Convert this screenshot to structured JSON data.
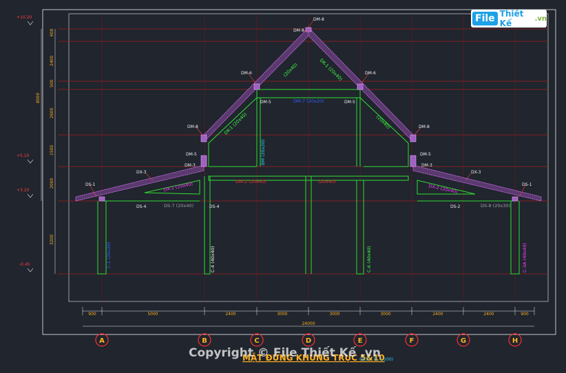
{
  "title": "MẶT ĐỨNG KHUNG TRỤC 5&10",
  "title_scale": "(SCX - TL 1:100)",
  "watermark": "Copyright © File Thiết Kế .vn",
  "logo": {
    "file": "File",
    "thiet_ke": "Thiết Kế",
    "domain": ".vn"
  },
  "levels": [
    "+10.20",
    "+5.10",
    "+3.20",
    "-0.45"
  ],
  "vertical_dims": [
    "600",
    "2400",
    "500",
    "2600",
    "1500",
    "2000",
    "3200",
    "8000"
  ],
  "axis_labels": [
    "A",
    "B",
    "C",
    "D",
    "E",
    "F",
    "G",
    "H"
  ],
  "bottom_dims": [
    "900",
    "5000",
    "2400",
    "3000",
    "3000",
    "3000",
    "2400",
    "2400",
    "900"
  ],
  "total_dim": "24000",
  "node_labels": {
    "dm_top": "DM-8",
    "dm_left_top": "DM-8",
    "dm_right_top": "DM-8",
    "dm_left_mid": "DM-6",
    "dm_right_mid": "DM-6",
    "dm_left_5": "DM-5",
    "dm_right_5": "DM-5",
    "dm_left_low": "DM-5",
    "dm_right_low": "DM-5",
    "dm_left_3": "DM-3",
    "dm_right_3": "DM-3",
    "ds_left_1": "DS-1",
    "ds_right_1": "DS-1",
    "dx_left_3": "DX-3",
    "dx_right_3": "DX-3",
    "ds_left_4": "DS-4",
    "ds_left_4b": "DS-4",
    "ds_right_2": "DS-2"
  },
  "member_labels": {
    "dk_left": "DK-1 (20x40)",
    "dk_right": "DK-1 (20x40)",
    "rafter_left_top": "(20x40)",
    "rafter_right_top": "(20x40)",
    "dm_beam": "DM-7 (20x20)",
    "dm2": "DM-2 (20x40)",
    "dm2_right": "(20x40)",
    "dx_left": "DX-1 (20x40)",
    "dx_right": "DX-2 (20x40)",
    "ds7": "DS-7 (20x40)",
    "ds8": "DS-8 (20x30)",
    "col_b": "C-4 (40x40)",
    "col_e": "C-6 (40x40)",
    "col_h": "C-3A (40x40)",
    "col_a": "C-1 (20x20)",
    "bm": "BM (20x20)"
  }
}
